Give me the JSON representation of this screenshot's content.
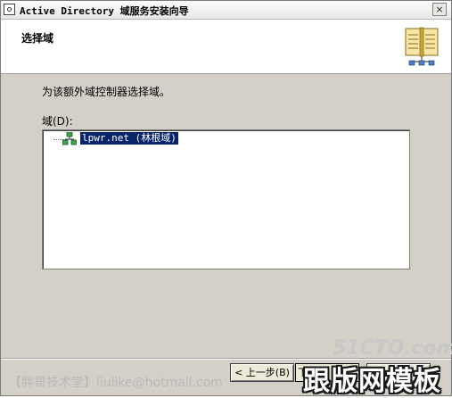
{
  "window": {
    "title": "Active Directory 域服务安装向导",
    "close_glyph": "×"
  },
  "header": {
    "title": "选择域",
    "icon": "book-icon"
  },
  "body": {
    "instruction": "为该额外域控制器选择域。",
    "domain_label": "域(D):",
    "tree": {
      "items": [
        {
          "label": "lpwr.net (林根域)",
          "selected": true,
          "icon": "domain-tree-icon"
        }
      ]
    }
  },
  "buttons": {
    "back": "< 上一步(B)",
    "next": "下",
    "cancel": ""
  },
  "watermarks": {
    "left": "【胖哥技术堂】liulike@hotmail.com",
    "site": "51CTO.com",
    "right": "跟版网模板"
  },
  "colors": {
    "selection": "#0a246a",
    "dialog_bg": "#d4d0c8"
  }
}
